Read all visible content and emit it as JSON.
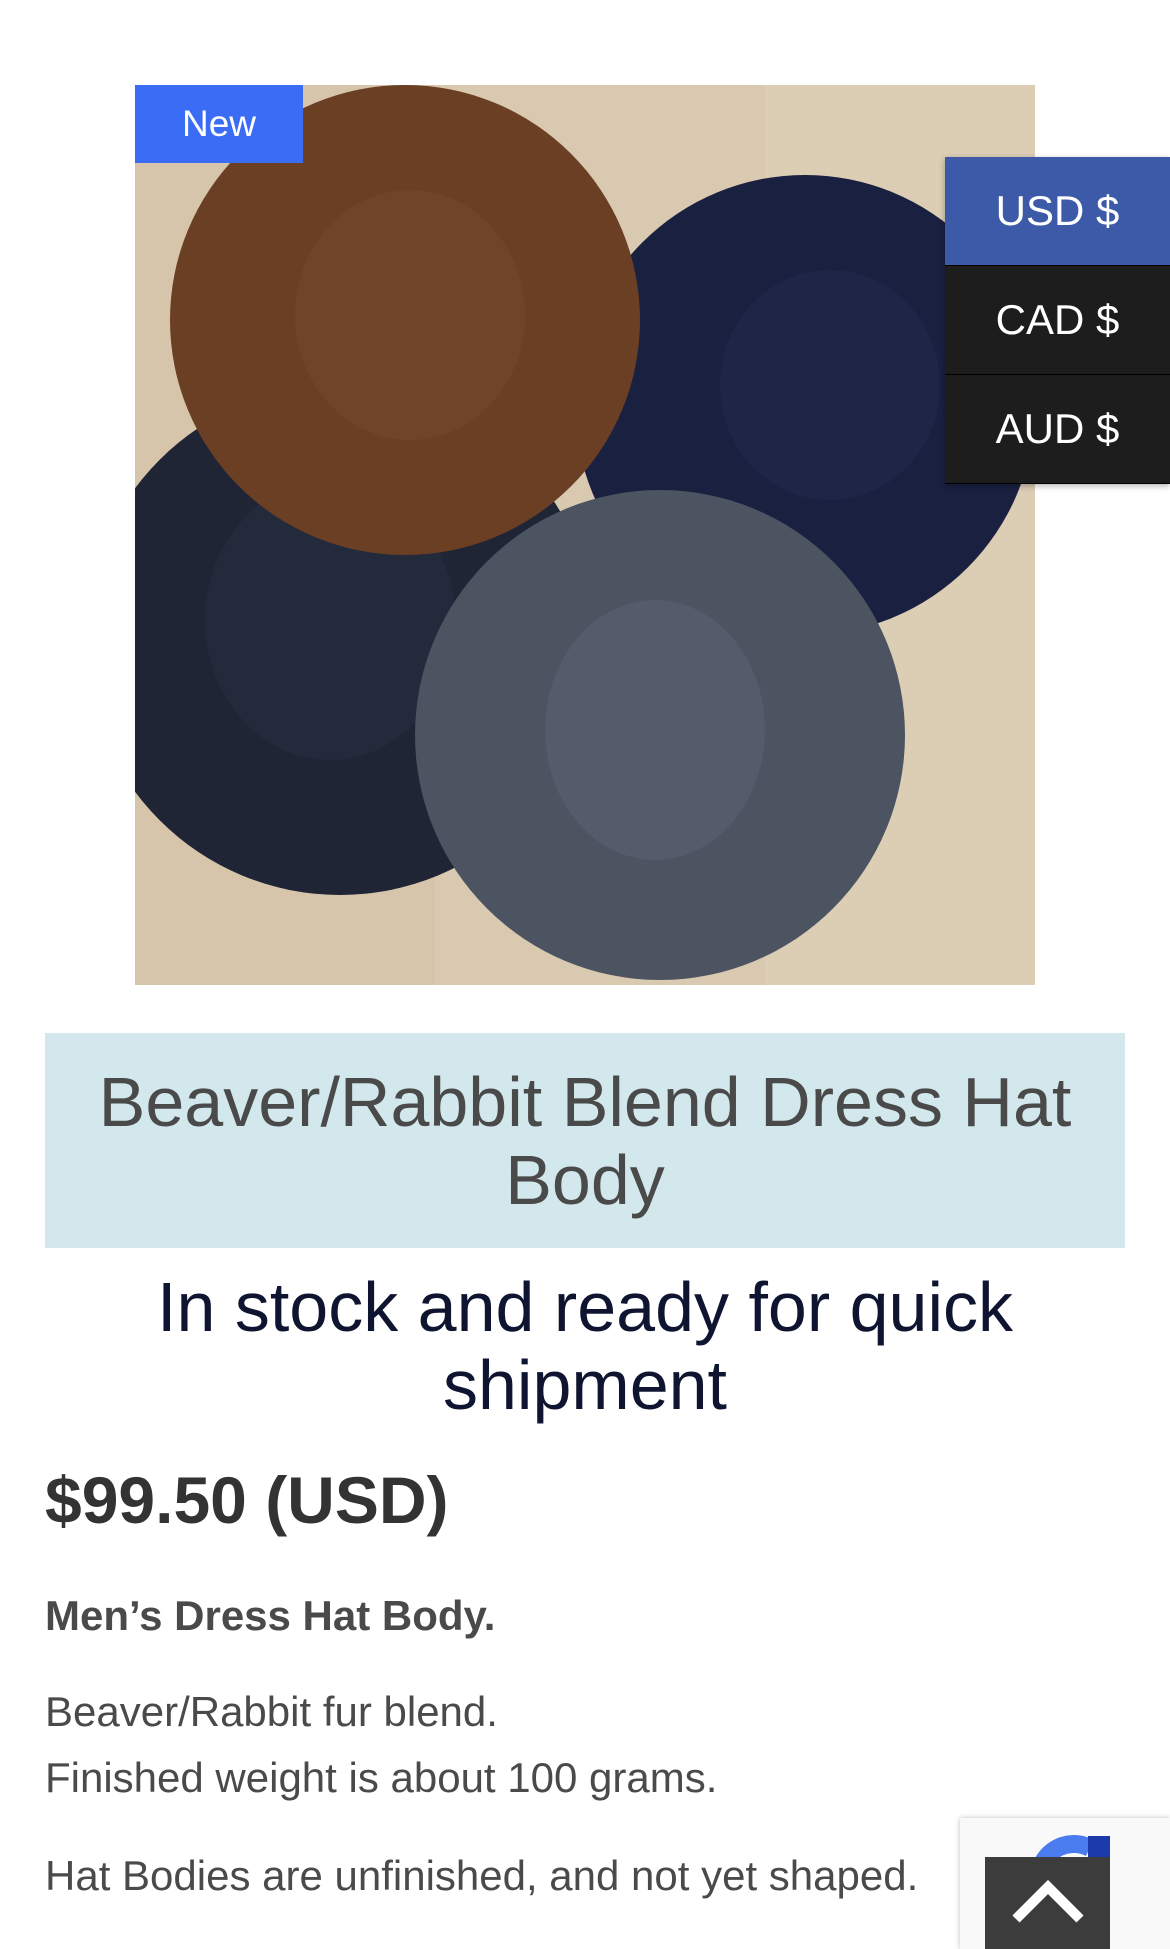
{
  "badge": {
    "label": "New"
  },
  "currency": {
    "options": [
      {
        "label": "USD $",
        "active": true
      },
      {
        "label": "CAD $",
        "active": false
      },
      {
        "label": "AUD $",
        "active": false
      }
    ]
  },
  "product": {
    "title": "Beaver/Rabbit Blend Dress Hat Body",
    "stock": "In stock and ready for quick shipment",
    "price": "$99.50 (USD)",
    "description": {
      "heading": "Men’s Dress Hat Body.",
      "line1": "Beaver/Rabbit fur blend.",
      "line2": "Finished weight is about 100 grams.",
      "line3": "Hat Bodies are unfinished, and not yet shaped."
    }
  },
  "icons": {
    "scroll_top": "chevron-up-icon",
    "recaptcha": "recaptcha-icon"
  }
}
